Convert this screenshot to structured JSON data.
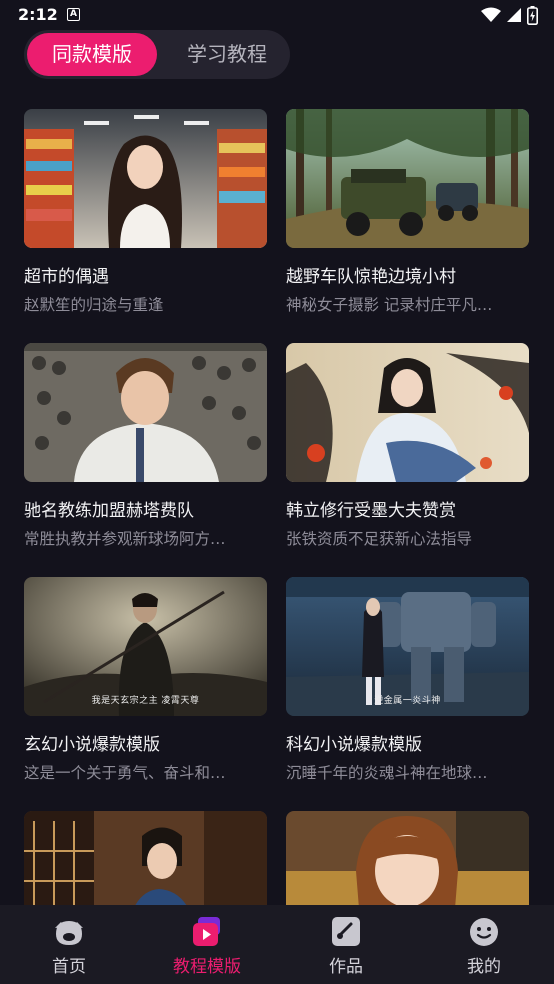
{
  "status_bar": {
    "time": "2:12",
    "notification_letter": "A"
  },
  "top_tabs": [
    {
      "label": "同款模版",
      "active": true
    },
    {
      "label": "学习教程",
      "active": false
    }
  ],
  "cards": [
    {
      "title": "超市的偶遇",
      "subtitle": "赵默笙的归途与重逢",
      "image": "anime girl in supermarket aisle"
    },
    {
      "title": "越野车队惊艳边境小村",
      "subtitle": "神秘女子摄影 记录村庄平凡…",
      "image": "off-road jeeps on forest road"
    },
    {
      "title": "驰名教练加盟赫塔费队",
      "subtitle": "常胜执教并参观新球场阿方…",
      "image": "coach in white shirt in stadium crowd"
    },
    {
      "title": "韩立修行受墨大夫赞赏",
      "subtitle": "张铁资质不足获新心法指导",
      "image": "long-haired cultivator in blue robe"
    },
    {
      "title": "玄幻小说爆款模版",
      "subtitle": "这是一个关于勇气、奋斗和…",
      "image": "dark robed warrior with spear",
      "caption": "我是天玄宗之主 凌霄天尊"
    },
    {
      "title": "科幻小说爆款模版",
      "subtitle": "沉睡千年的炎魂斗神在地球…",
      "image": "girl standing beside giant mech",
      "caption": "逆金属一炎斗神"
    },
    {
      "title": "",
      "subtitle": "",
      "image": "woman in blue kimono by wooden window"
    },
    {
      "title": "",
      "subtitle": "",
      "image": "brown-haired anime girl on sofa"
    }
  ],
  "bottom_nav": [
    {
      "label": "首页",
      "icon": "home-mascot-icon",
      "active": false
    },
    {
      "label": "教程模版",
      "icon": "template-play-icon",
      "active": true
    },
    {
      "label": "作品",
      "icon": "brush-icon",
      "active": false
    },
    {
      "label": "我的",
      "icon": "smiley-profile-icon",
      "active": false
    }
  ],
  "colors": {
    "accent": "#ec1d6f",
    "background": "#13121c",
    "nav_background": "#1b1a23"
  }
}
